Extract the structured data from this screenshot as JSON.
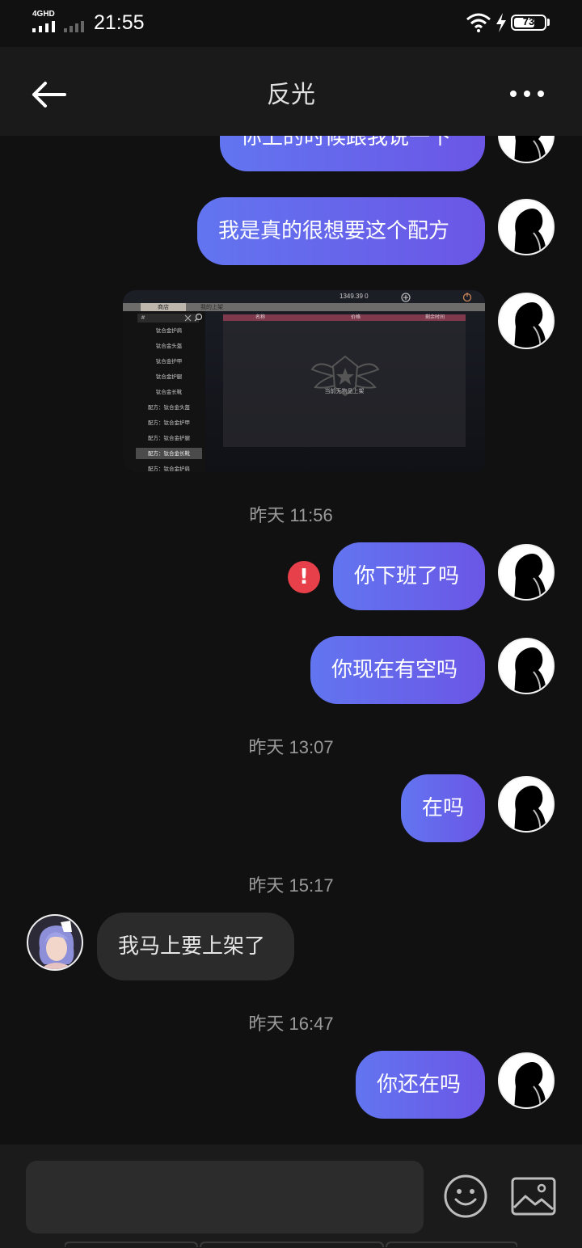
{
  "status_bar": {
    "network": "4GHD",
    "time": "21:55",
    "battery": "73",
    "battery_level": 0.73
  },
  "header": {
    "title": "反光",
    "back_icon": "arrow-left-icon",
    "more_icon": "more-horizontal-icon"
  },
  "messages": [
    {
      "type": "out",
      "text": "你上的时候跟我说一下"
    },
    {
      "type": "out",
      "text": "我是真的很想要这个配方"
    },
    {
      "type": "out_image",
      "image": {
        "stats": "1349.39   0",
        "tabs": [
          "商店",
          "我的上架"
        ],
        "search": "#",
        "columns": [
          "名称",
          "价格",
          "剩余时间"
        ],
        "items": [
          "钛合金护肩",
          "钛合金头盔",
          "钛合金护甲",
          "钛合金护腿",
          "钛合金长靴",
          "配方：钛合金头盔",
          "配方：钛合金护甲",
          "配方：钛合金护腿",
          "配方：钛合金长靴",
          "配方：钛合金护肩"
        ],
        "selected_item": "配方：钛合金长靴",
        "empty_text": "当前无物品上架"
      }
    },
    {
      "type": "time",
      "text": "昨天 11:56"
    },
    {
      "type": "out",
      "text": "你下班了吗",
      "status": "failed"
    },
    {
      "type": "out",
      "text": "你现在有空吗"
    },
    {
      "type": "time",
      "text": "昨天 13:07"
    },
    {
      "type": "out",
      "text": "在吗"
    },
    {
      "type": "time",
      "text": "昨天 15:17"
    },
    {
      "type": "in",
      "text": "我马上要上架了"
    },
    {
      "type": "time",
      "text": "昨天 16:47"
    },
    {
      "type": "out",
      "text": "你还在吗"
    }
  ],
  "input_bar": {
    "placeholder": "",
    "emoji_icon": "smiley-icon",
    "image_icon": "image-icon"
  },
  "colors": {
    "background": "#111111",
    "bubble_out_start": "#6275f0",
    "bubble_out_end": "#6b56e6",
    "bubble_in": "#2b2b2b",
    "error": "#e8404a"
  }
}
